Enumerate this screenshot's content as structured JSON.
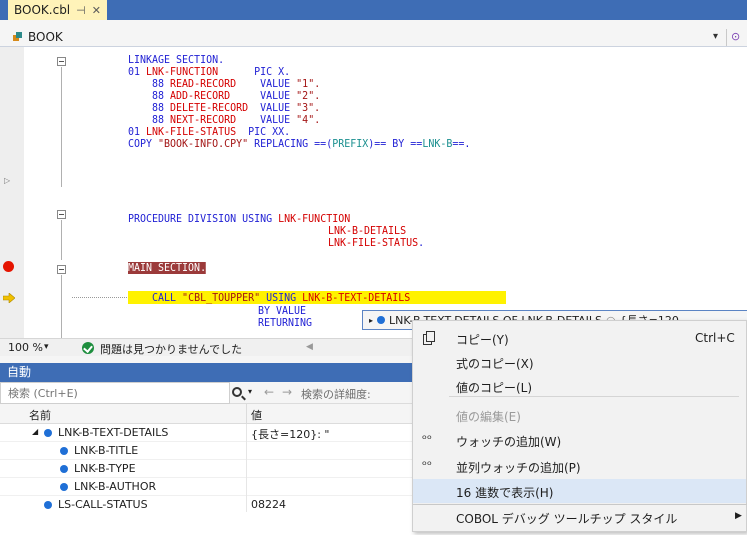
{
  "tab": {
    "title": "BOOK.cbl",
    "pin": "⊣",
    "close": "✕"
  },
  "navbar": {
    "scope": "BOOK"
  },
  "code": {
    "l1": "LINKAGE SECTION.",
    "l2_num": "01 ",
    "l2_name": "LNK-FUNCTION",
    "l2_pic": "      PIC X.",
    "l3_num": "    88 ",
    "l3_name": "READ-RECORD",
    "l3_val": "    VALUE ",
    "l3_str": "\"1\".",
    "l4_num": "    88 ",
    "l4_name": "ADD-RECORD",
    "l4_val": "     VALUE ",
    "l4_str": "\"2\".",
    "l5_num": "    88 ",
    "l5_name": "DELETE-RECORD",
    "l5_val": "  VALUE ",
    "l5_str": "\"3\".",
    "l6_num": "    88 ",
    "l6_name": "NEXT-RECORD",
    "l6_val": "    VALUE ",
    "l6_str": "\"4\".",
    "l7_num": "01 ",
    "l7_name": "LNK-FILE-STATUS",
    "l7_pic": "  PIC XX.",
    "l8_copy": "COPY ",
    "l8_str": "\"BOOK-INFO.CPY\"",
    "l8_rep": " REPLACING ==(",
    "l8_prefix": "PREFIX",
    "l8_rest": ")== BY ==",
    "l8_lnk": "LNK-B",
    "l8_end": "==.",
    "l9_kw": "PROCEDURE DIVISION USING ",
    "l9_arg": "LNK-FUNCTION",
    "l10_arg": "LNK-B-DETAILS",
    "l11_arg": "LNK-FILE-STATUS",
    "l11_end": ".",
    "l12": "MAIN SECTION.",
    "l13_call": "    CALL ",
    "l13_str": "\"CBL_TOUPPER\"",
    "l13_using": " USING ",
    "l13_arg": "LNK-B-TEXT-DETAILS",
    "l14": "BY VALUE",
    "l15": "RETURNING"
  },
  "datatip": {
    "text": "LNK-B-TEXT-DETAILS OF LNK-B-DETAILS",
    "suffix": "{長さ=120"
  },
  "status": {
    "zoom": "100 %",
    "issues": "問題は見つかりませんでした"
  },
  "autos": {
    "title": "自動",
    "search_placeholder": "検索 (Ctrl+E)",
    "depth_label": "検索の詳細度:",
    "col_name": "名前",
    "col_value": "値",
    "rows": [
      {
        "name": "LNK-B-TEXT-DETAILS",
        "value": "{長さ=120}: \""
      },
      {
        "name": "LNK-B-TITLE",
        "value": ""
      },
      {
        "name": "LNK-B-TYPE",
        "value": ""
      },
      {
        "name": "LNK-B-AUTHOR",
        "value": ""
      },
      {
        "name": "LS-CALL-STATUS",
        "value": "08224"
      }
    ]
  },
  "context_menu": {
    "copy": "コピー(Y)",
    "copy_shortcut": "Ctrl+C",
    "copy_expression": "式のコピー(X)",
    "copy_value": "値のコピー(L)",
    "edit_value": "値の編集(E)",
    "add_watch": "ウォッチの追加(W)",
    "add_parallel_watch": "並列ウォッチの追加(P)",
    "hex_display": "16 進数で表示(H)",
    "cobol_datatip_style": "COBOL デバッグ ツールチップ スタイル"
  },
  "colors": {
    "accent": "#3e6db5",
    "keyword": "#1f1fd4",
    "identifier": "#d40000",
    "current_line": "#fff200",
    "breakpoint": "#e51400"
  }
}
